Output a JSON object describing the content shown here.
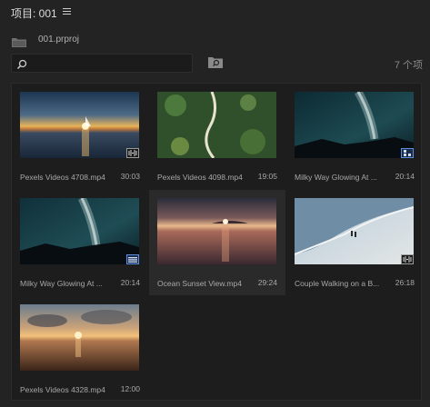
{
  "panel": {
    "title": "项目: 001"
  },
  "bin": {
    "name": "001.prproj"
  },
  "search": {
    "value": "",
    "placeholder": ""
  },
  "item_count": "7 个项",
  "items": [
    {
      "name": "Pexels Videos 4708.mp4",
      "duration": "30:03",
      "thumb": "sunset-sailboat",
      "badge": "audio-video"
    },
    {
      "name": "Pexels Videos 4098.mp4",
      "duration": "19:05",
      "thumb": "forest-road",
      "badge": "none"
    },
    {
      "name": "Milky Way Glowing At ...",
      "duration": "20:14",
      "thumb": "milky-way",
      "badge": "sequence"
    },
    {
      "name": "Milky Way Glowing At ...",
      "duration": "20:14",
      "thumb": "milky-way",
      "badge": "sequence-selected"
    },
    {
      "name": "Ocean Sunset View.mp4",
      "duration": "29:24",
      "thumb": "ocean-sunset",
      "badge": "none"
    },
    {
      "name": "Couple Walking on a B...",
      "duration": "26:18",
      "thumb": "beach-couple",
      "badge": "audio-video"
    },
    {
      "name": "Pexels Videos 4328.mp4",
      "duration": "12:00",
      "thumb": "beach-sunset",
      "badge": "none"
    }
  ],
  "colors": {
    "background": "#232323",
    "grid": "#1d1d1d",
    "accent": "#5b8de0"
  }
}
